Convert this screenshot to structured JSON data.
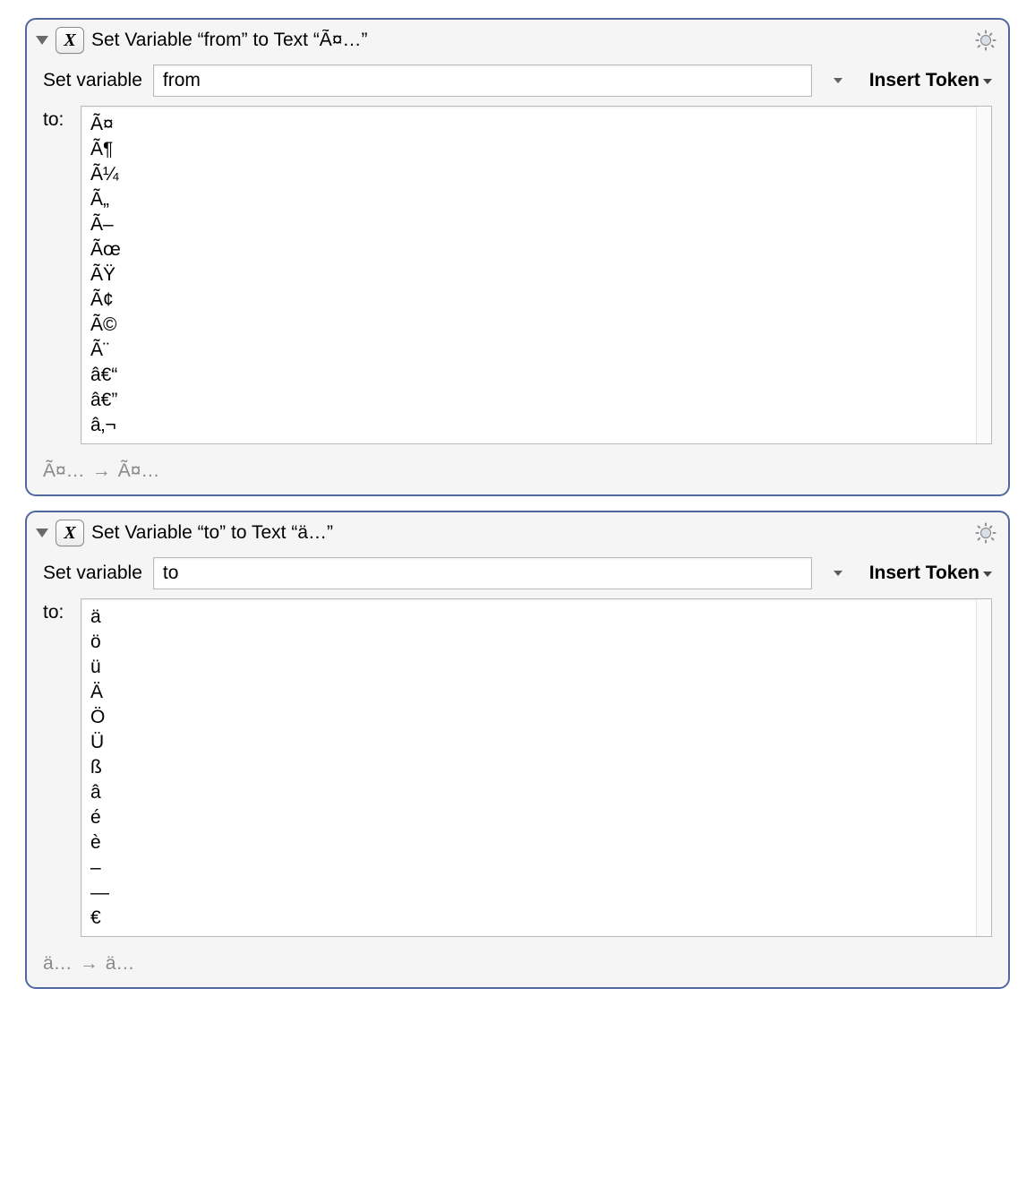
{
  "blocks": [
    {
      "icon_glyph": "X",
      "title": "Set Variable “from” to Text “Ã¤…”",
      "set_variable_label": "Set variable",
      "variable_name": "from",
      "insert_token_label": "Insert Token",
      "to_label": "to:",
      "to_text": "Ã¤\nÃ¶\nÃ¼\nÃ„\nÃ–\nÃœ\nÃŸ\nÃ¢\nÃ©\nÃ¨\nâ€“\nâ€”\nâ‚¬",
      "preview_from": "Ã¤…",
      "preview_to": "Ã¤…"
    },
    {
      "icon_glyph": "X",
      "title": "Set Variable “to” to Text “ä…”",
      "set_variable_label": "Set variable",
      "variable_name": "to",
      "insert_token_label": "Insert Token",
      "to_label": "to:",
      "to_text": "ä\nö\nü\nÄ\nÖ\nÜ\nß\nâ\né\nè\n–\n—\n€",
      "preview_from": "ä…",
      "preview_to": "ä…"
    }
  ]
}
